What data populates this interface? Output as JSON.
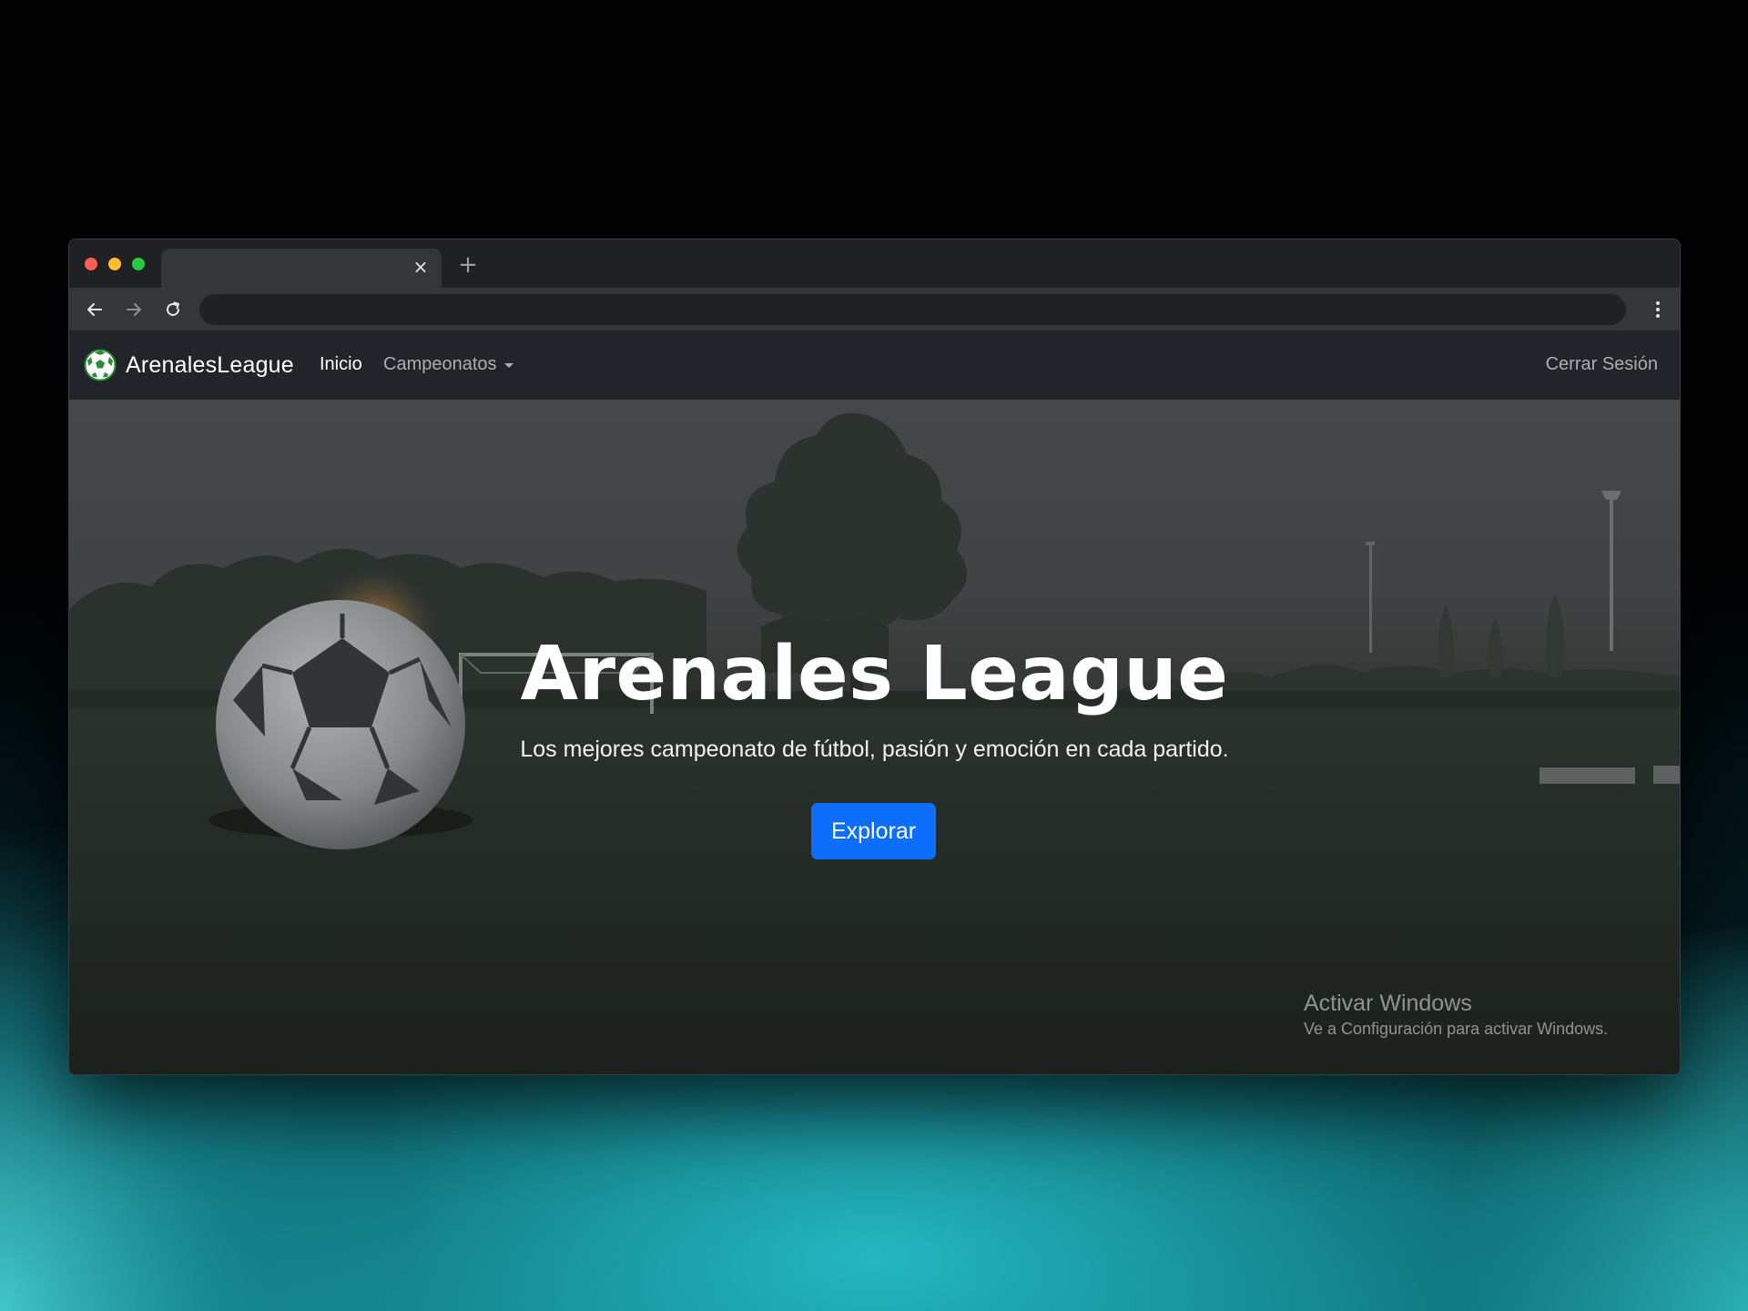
{
  "browser": {
    "tab": {
      "title": "",
      "close_icon": "close-icon"
    },
    "new_tab_icon": "plus-icon",
    "address_bar": {
      "value": "",
      "placeholder": ""
    },
    "icons": [
      "back-arrow-icon",
      "forward-arrow-icon",
      "reload-icon",
      "kebab-menu-icon"
    ]
  },
  "navbar": {
    "brand": {
      "name": "ArenalesLeague",
      "logo_icon": "soccer-ball-icon"
    },
    "links": {
      "home": "Inicio",
      "championships": "Campeonatos",
      "logout": "Cerrar Sesión"
    }
  },
  "hero": {
    "title": "Arenales League",
    "subtitle": "Los mejores campeonato de fútbol, pasión y emoción en cada partido.",
    "cta": "Explorar"
  },
  "watermark": {
    "title": "Activar Windows",
    "subtitle": "Ve a Configuración para activar Windows."
  },
  "colors": {
    "primary_button": "#0d6efd",
    "navbar_bg": "#212529",
    "browser_chrome": "#202124",
    "toolbar": "#35363a"
  }
}
